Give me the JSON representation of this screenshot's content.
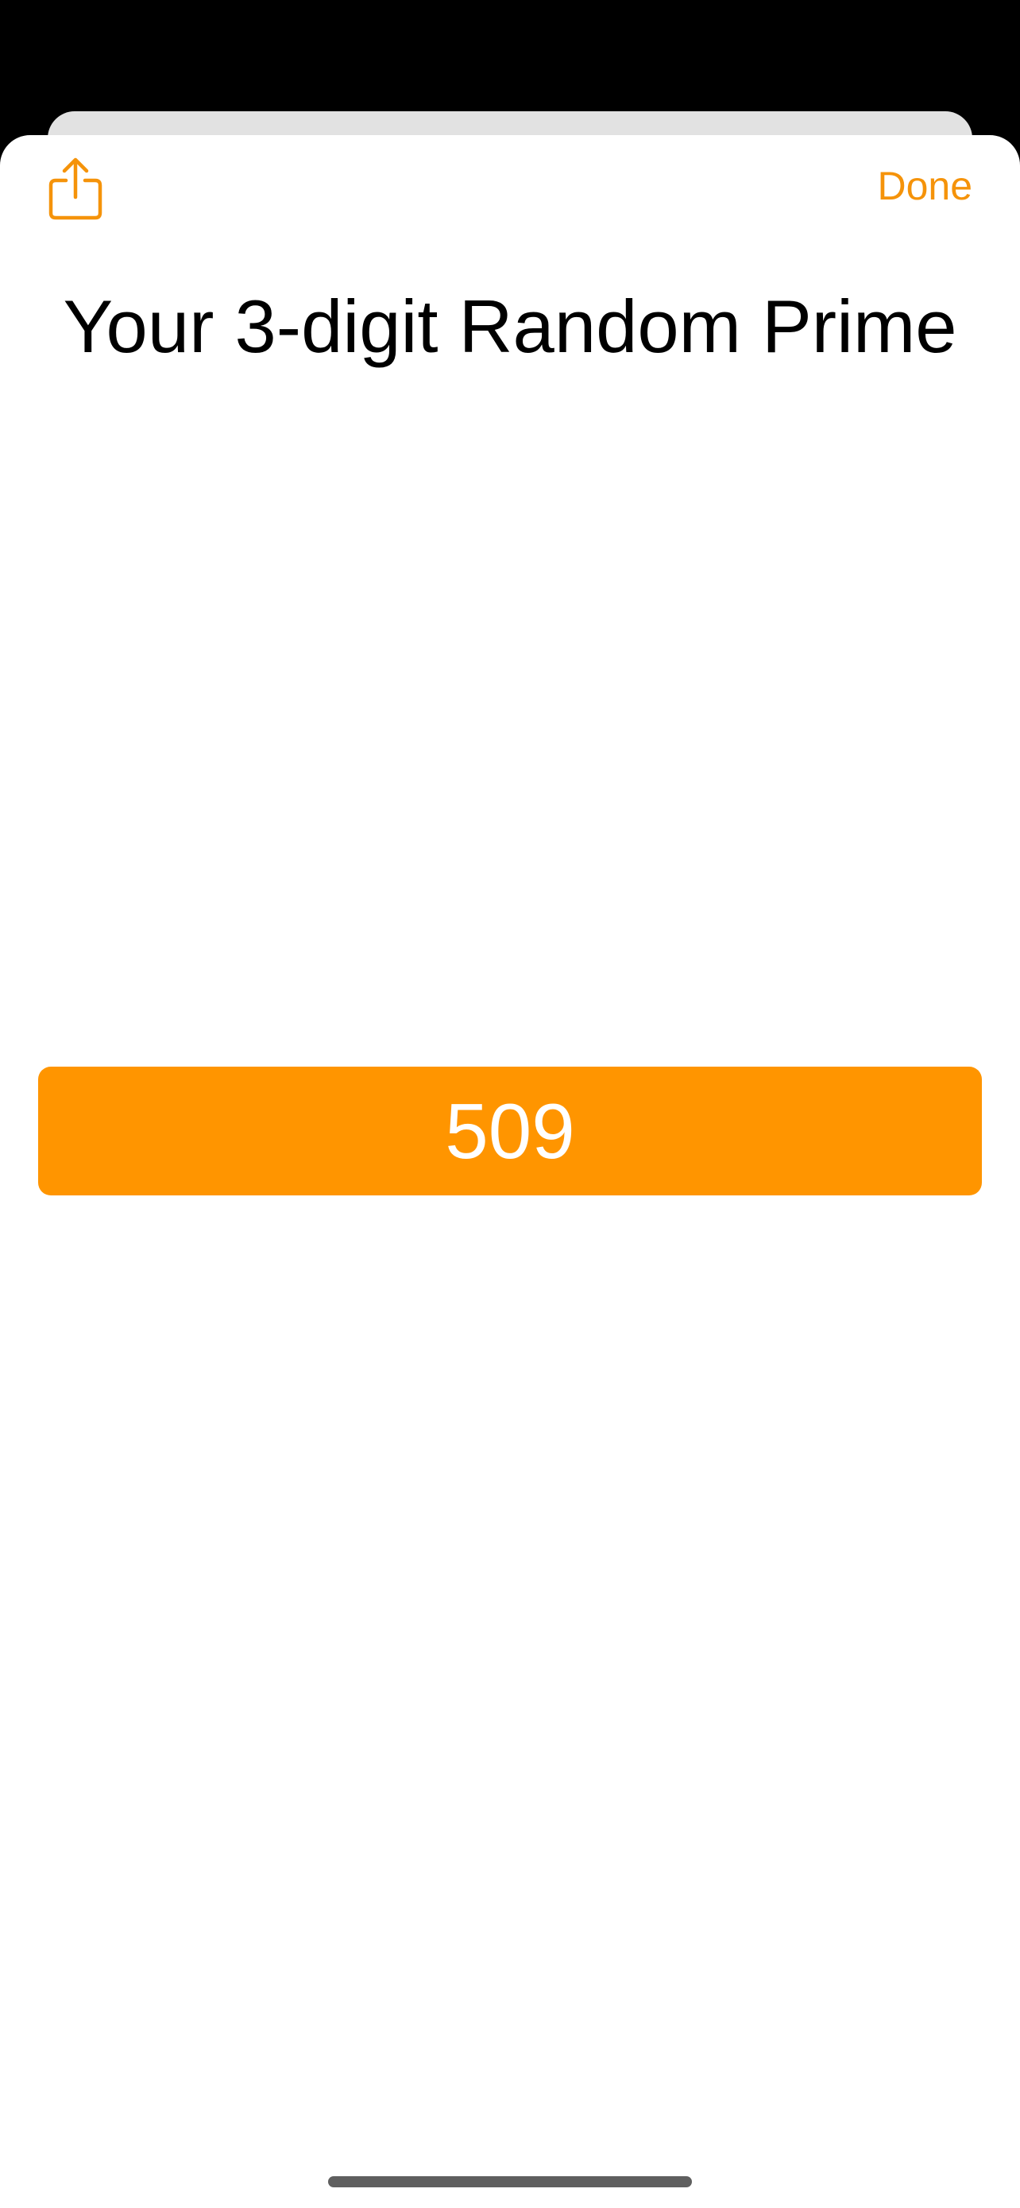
{
  "toolbar": {
    "share_icon": "share-icon",
    "done_label": "Done"
  },
  "content": {
    "title": "Your 3-digit Random Prime",
    "result_value": "509"
  },
  "colors": {
    "accent": "#ff9500",
    "accent_text": "#f5930a",
    "background_behind_sheet": "#000000",
    "sheet": "#ffffff"
  }
}
